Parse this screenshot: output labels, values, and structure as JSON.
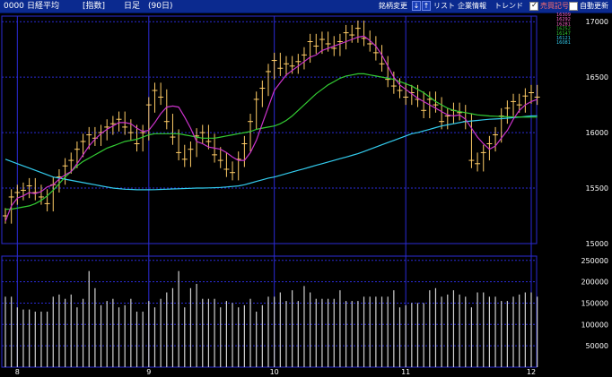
{
  "toolbar": {
    "code": "0000",
    "name": "日経平均",
    "type": "[指数]",
    "period": "日足",
    "range": "(90日)",
    "change_label": "銘柄変更",
    "list_label": "リスト",
    "company_label": "企業情報",
    "trend_label": "トレンド",
    "chk1_label": "売買記号",
    "chk2_label": "自動更新",
    "down_arrow": "↓",
    "up_arrow": "↑"
  },
  "legend_values": [
    "16309",
    "16292",
    "16281",
    "16252",
    "16147",
    "16121",
    "16081"
  ],
  "colors": {
    "bg": "#000000",
    "grid": "#2b2bd6",
    "candle": "#ffcc66",
    "ma_short": "#cc33cc",
    "ma_mid": "#33cc33",
    "ma_long": "#33ccee",
    "volume": "#d0d0d0",
    "axis_text": "#ffffff"
  },
  "chart_data": {
    "type": "candlestick",
    "price_axis": {
      "ticks": [
        17000,
        16500,
        16000,
        15500,
        15000
      ],
      "range": [
        15000,
        17050
      ]
    },
    "volume_axis": {
      "ticks": [
        250000,
        200000,
        150000,
        100000,
        50000
      ],
      "range": [
        0,
        260000
      ]
    },
    "month_labels": [
      {
        "label": "8",
        "index": 2
      },
      {
        "label": "9",
        "index": 24
      },
      {
        "label": "10",
        "index": 45
      },
      {
        "label": "11",
        "index": 67
      },
      {
        "label": "12",
        "index": 88
      }
    ],
    "closes": [
      15250,
      15420,
      15460,
      15480,
      15520,
      15460,
      15420,
      15360,
      15530,
      15600,
      15700,
      15750,
      15850,
      15920,
      15980,
      15950,
      16000,
      16050,
      16080,
      16120,
      16050,
      16000,
      15900,
      16000,
      16250,
      16380,
      16320,
      16100,
      15960,
      15820,
      15760,
      15850,
      15970,
      16000,
      15920,
      15800,
      15750,
      15670,
      15640,
      15760,
      15900,
      16100,
      16300,
      16400,
      16550,
      16650,
      16580,
      16620,
      16600,
      16640,
      16700,
      16820,
      16780,
      16840,
      16800,
      16760,
      16820,
      16900,
      16880,
      16940,
      16850,
      16800,
      16720,
      16620,
      16480,
      16420,
      16380,
      16320,
      16360,
      16300,
      16200,
      16300,
      16250,
      16100,
      16150,
      16200,
      16180,
      16100,
      15750,
      15720,
      15820,
      15900,
      15980,
      16150,
      16220,
      16280,
      16250,
      16330,
      16360,
      16320
    ],
    "ma_short_extra": [
      15200,
      15340,
      15410,
      15430,
      15460,
      15450,
      15470,
      15510,
      15530,
      15580,
      15620,
      15650,
      15720,
      15800,
      15880,
      15940,
      15990,
      16030,
      16060,
      16090,
      16090,
      16080,
      16040,
      16010,
      16020,
      16090,
      16170,
      16230,
      16240,
      16230,
      16140,
      16040,
      15920,
      15900,
      15870,
      15860,
      15850,
      15820,
      15780,
      15750,
      15750,
      15820,
      15930,
      16080,
      16230,
      16380,
      16450,
      16520,
      16560,
      16600,
      16640,
      16680,
      16700,
      16740,
      16760,
      16780,
      16800,
      16820,
      16840,
      16860,
      16870,
      16830,
      16780,
      16700,
      16600,
      16500,
      16430,
      16390,
      16350,
      16310,
      16280,
      16250,
      16220,
      16190,
      16160,
      16150,
      16160,
      16120,
      16040,
      15960,
      15900,
      15850,
      15880,
      15950,
      16020,
      16120,
      16200,
      16250,
      16280,
      16300
    ],
    "ma_mid": [
      15310,
      15310,
      15320,
      15330,
      15340,
      15360,
      15390,
      15430,
      15480,
      15540,
      15600,
      15650,
      15700,
      15740,
      15770,
      15800,
      15830,
      15860,
      15880,
      15900,
      15920,
      15930,
      15940,
      15960,
      15980,
      15990,
      15990,
      15990,
      15990,
      15990,
      15980,
      15970,
      15960,
      15950,
      15950,
      15950,
      15960,
      15970,
      15980,
      15990,
      16000,
      16010,
      16030,
      16040,
      16050,
      16060,
      16080,
      16110,
      16150,
      16200,
      16250,
      16300,
      16350,
      16390,
      16430,
      16460,
      16490,
      16510,
      16520,
      16530,
      16530,
      16520,
      16510,
      16500,
      16490,
      16480,
      16460,
      16440,
      16420,
      16390,
      16360,
      16320,
      16280,
      16250,
      16220,
      16200,
      16190,
      16180,
      16170,
      16160,
      16155,
      16150,
      16148,
      16145,
      16143,
      16142,
      16141,
      16140,
      16140,
      16140
    ],
    "ma_long": [
      15760,
      15740,
      15720,
      15700,
      15680,
      15660,
      15640,
      15620,
      15600,
      15590,
      15580,
      15570,
      15560,
      15550,
      15540,
      15530,
      15520,
      15510,
      15500,
      15495,
      15490,
      15488,
      15485,
      15485,
      15485,
      15486,
      15488,
      15490,
      15492,
      15494,
      15496,
      15498,
      15500,
      15500,
      15502,
      15504,
      15506,
      15510,
      15515,
      15520,
      15530,
      15545,
      15560,
      15575,
      15590,
      15600,
      15615,
      15630,
      15645,
      15660,
      15675,
      15690,
      15705,
      15720,
      15735,
      15750,
      15765,
      15780,
      15795,
      15810,
      15830,
      15850,
      15870,
      15890,
      15910,
      15930,
      15950,
      15970,
      15990,
      16000,
      16015,
      16030,
      16045,
      16060,
      16070,
      16080,
      16090,
      16100,
      16105,
      16110,
      16115,
      16120,
      16123,
      16126,
      16130,
      16135,
      16140,
      16145,
      16150,
      16152
    ],
    "volumes": [
      165000,
      165000,
      140000,
      135000,
      135000,
      130000,
      130000,
      130000,
      165000,
      170000,
      160000,
      170000,
      140000,
      160000,
      225000,
      185000,
      145000,
      155000,
      160000,
      140000,
      145000,
      160000,
      130000,
      130000,
      155000,
      140000,
      160000,
      175000,
      185000,
      225000,
      140000,
      185000,
      195000,
      160000,
      160000,
      160000,
      140000,
      155000,
      150000,
      140000,
      145000,
      160000,
      130000,
      145000,
      165000,
      165000,
      175000,
      155000,
      180000,
      155000,
      190000,
      175000,
      160000,
      160000,
      160000,
      160000,
      180000,
      155000,
      155000,
      155000,
      165000,
      165000,
      165000,
      165000,
      165000,
      180000,
      140000,
      145000,
      150000,
      150000,
      150000,
      180000,
      185000,
      165000,
      170000,
      180000,
      170000,
      165000,
      140000,
      175000,
      175000,
      165000,
      165000,
      155000,
      155000,
      165000,
      170000,
      175000,
      175000,
      165000
    ]
  }
}
